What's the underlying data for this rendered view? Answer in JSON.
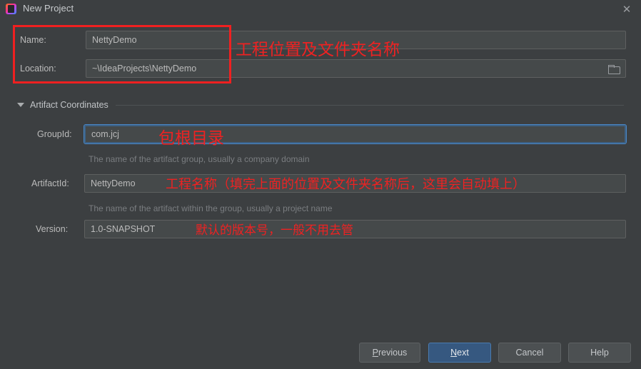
{
  "window": {
    "title": "New Project",
    "app_icon": "intellij-idea-icon",
    "close_icon": "close-icon"
  },
  "form": {
    "name": {
      "label": "Name:",
      "value": "NettyDemo"
    },
    "location": {
      "label": "Location:",
      "value": "~\\IdeaProjects\\NettyDemo",
      "browse_icon": "folder-icon"
    },
    "section": {
      "title": "Artifact Coordinates",
      "expanded_icon": "chevron-down-icon"
    },
    "group_id": {
      "label": "GroupId:",
      "value": "com.jcj",
      "hint": "The name of the artifact group, usually a company domain",
      "focused": true
    },
    "artifact_id": {
      "label": "ArtifactId:",
      "value": "NettyDemo",
      "hint": "The name of the artifact within the group, usually a project name"
    },
    "version": {
      "label": "Version:",
      "value": "1.0-SNAPSHOT"
    }
  },
  "annotations": [
    {
      "text": "工程位置及文件夹名称"
    },
    {
      "text": "包根目录"
    },
    {
      "text": "工程名称（填完上面的位置及文件夹名称后，这里会自动填上）"
    },
    {
      "text": "默认的版本号，一般不用去管"
    }
  ],
  "buttons": {
    "previous": {
      "mnemonic": "P",
      "rest": "revious"
    },
    "next": {
      "mnemonic": "N",
      "rest": "ext"
    },
    "cancel": "Cancel",
    "help": "Help"
  },
  "colors": {
    "dialog_bg": "#3c3f41",
    "field_bg": "#45494a",
    "accent_blue": "#365880",
    "annotation_red": "#ee2222",
    "text": "#bbbbbb"
  }
}
